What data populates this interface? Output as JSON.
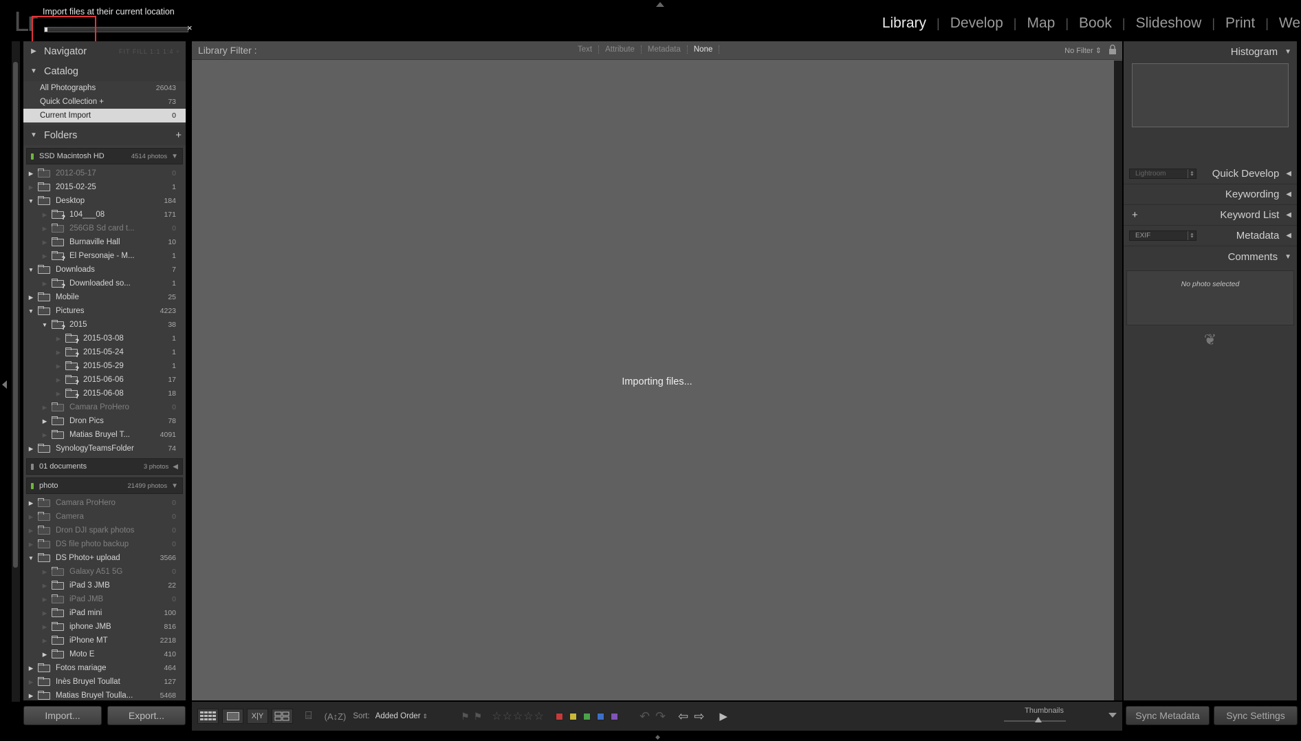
{
  "app": {
    "logo": "Lr"
  },
  "import_status": {
    "label": "Import files at their current location",
    "progress_pct": 2,
    "close_glyph": "×"
  },
  "modules": [
    "Library",
    "Develop",
    "Map",
    "Book",
    "Slideshow",
    "Print",
    "We"
  ],
  "active_module": "Library",
  "left": {
    "navigator": {
      "title": "Navigator",
      "zoom_options": "FIT  FILL  1:1  1:4 ÷"
    },
    "catalog": {
      "title": "Catalog",
      "items": [
        {
          "label": "All Photographs",
          "count": "26043"
        },
        {
          "label": "Quick Collection  +",
          "count": "73"
        },
        {
          "label": "Current Import",
          "count": "0"
        }
      ]
    },
    "folders": {
      "title": "Folders",
      "add": "+",
      "volumes": [
        {
          "name": "SSD Macintosh HD",
          "count": "4514 photos",
          "toggle": "▼",
          "led": "green"
        },
        {
          "name": "01 documents",
          "count": "3 photos",
          "toggle": "◀",
          "led": "gray"
        },
        {
          "name": "photo",
          "count": "21499 photos",
          "toggle": "▼",
          "led": "green"
        }
      ],
      "vol1_rows": [
        {
          "name": "2012-05-17",
          "count": "0",
          "level": 1,
          "dim": true,
          "tri": "▶",
          "q": false
        },
        {
          "name": "2015-02-25",
          "count": "1",
          "level": 1,
          "dim": false,
          "tri": "",
          "q": false
        },
        {
          "name": "Desktop",
          "count": "184",
          "level": 1,
          "dim": false,
          "tri": "▼",
          "q": false
        },
        {
          "name": "104___08",
          "count": "171",
          "level": 2,
          "dim": false,
          "tri": "",
          "q": true
        },
        {
          "name": "256GB Sd card t...",
          "count": "0",
          "level": 2,
          "dim": true,
          "tri": "",
          "q": false
        },
        {
          "name": "Burnaville Hall",
          "count": "10",
          "level": 2,
          "dim": false,
          "tri": "",
          "q": false
        },
        {
          "name": "El Personaje - M...",
          "count": "1",
          "level": 2,
          "dim": false,
          "tri": "",
          "q": true
        },
        {
          "name": "Downloads",
          "count": "7",
          "level": 1,
          "dim": false,
          "tri": "▼",
          "q": false
        },
        {
          "name": "Downloaded so...",
          "count": "1",
          "level": 2,
          "dim": false,
          "tri": "",
          "q": true
        },
        {
          "name": "Mobile",
          "count": "25",
          "level": 1,
          "dim": false,
          "tri": "▶",
          "q": false
        },
        {
          "name": "Pictures",
          "count": "4223",
          "level": 1,
          "dim": false,
          "tri": "▼",
          "q": false
        },
        {
          "name": "2015",
          "count": "38",
          "level": 2,
          "dim": false,
          "tri": "▼",
          "q": true
        },
        {
          "name": "2015-03-08",
          "count": "1",
          "level": 3,
          "dim": false,
          "tri": "",
          "q": true
        },
        {
          "name": "2015-05-24",
          "count": "1",
          "level": 3,
          "dim": false,
          "tri": "",
          "q": true
        },
        {
          "name": "2015-05-29",
          "count": "1",
          "level": 3,
          "dim": false,
          "tri": "",
          "q": true
        },
        {
          "name": "2015-06-06",
          "count": "17",
          "level": 3,
          "dim": false,
          "tri": "",
          "q": true
        },
        {
          "name": "2015-06-08",
          "count": "18",
          "level": 3,
          "dim": false,
          "tri": "",
          "q": true
        },
        {
          "name": "Camara ProHero",
          "count": "0",
          "level": 2,
          "dim": true,
          "tri": "",
          "q": false
        },
        {
          "name": "Dron Pics",
          "count": "78",
          "level": 2,
          "dim": false,
          "tri": "▶",
          "q": false
        },
        {
          "name": "Matias Bruyel T...",
          "count": "4091",
          "level": 2,
          "dim": false,
          "tri": "",
          "q": false
        },
        {
          "name": "SynologyTeamsFolder",
          "count": "74",
          "level": 1,
          "dim": false,
          "tri": "▶",
          "q": false
        }
      ],
      "vol3_rows": [
        {
          "name": "Camara ProHero",
          "count": "0",
          "level": 1,
          "dim": true,
          "tri": "▶",
          "q": false
        },
        {
          "name": "Camera",
          "count": "0",
          "level": 1,
          "dim": true,
          "tri": "",
          "q": false
        },
        {
          "name": "Dron DJI spark photos",
          "count": "0",
          "level": 1,
          "dim": true,
          "tri": "",
          "q": false
        },
        {
          "name": "DS file photo backup",
          "count": "0",
          "level": 1,
          "dim": true,
          "tri": "",
          "q": false
        },
        {
          "name": "DS Photo+ upload",
          "count": "3566",
          "level": 1,
          "dim": false,
          "tri": "▼",
          "q": false
        },
        {
          "name": "Galaxy A51 5G",
          "count": "0",
          "level": 2,
          "dim": true,
          "tri": "",
          "q": false
        },
        {
          "name": "iPad 3 JMB",
          "count": "22",
          "level": 2,
          "dim": false,
          "tri": "",
          "q": false
        },
        {
          "name": "iPad JMB",
          "count": "0",
          "level": 2,
          "dim": true,
          "tri": "",
          "q": false
        },
        {
          "name": "iPad mini",
          "count": "100",
          "level": 2,
          "dim": false,
          "tri": "",
          "q": false
        },
        {
          "name": "iphone JMB",
          "count": "816",
          "level": 2,
          "dim": false,
          "tri": "",
          "q": false
        },
        {
          "name": "iPhone MT",
          "count": "2218",
          "level": 2,
          "dim": false,
          "tri": "",
          "q": false
        },
        {
          "name": "Moto E",
          "count": "410",
          "level": 2,
          "dim": false,
          "tri": "▶",
          "q": false
        },
        {
          "name": "Fotos mariage",
          "count": "464",
          "level": 1,
          "dim": false,
          "tri": "▶",
          "q": false
        },
        {
          "name": "Inès Bruyel Toullat",
          "count": "127",
          "level": 1,
          "dim": false,
          "tri": "",
          "q": false
        },
        {
          "name": "Matias Bruyel Toulla...",
          "count": "5468",
          "level": 1,
          "dim": false,
          "tri": "▶",
          "q": false
        }
      ]
    },
    "import_button": "Import...",
    "export_button": "Export..."
  },
  "center": {
    "filter_label": "Library Filter :",
    "filter_tabs": [
      "Text",
      "Attribute",
      "Metadata",
      "None"
    ],
    "active_filter": "None",
    "no_filter": "No Filter",
    "status": "Importing files..."
  },
  "toolbar": {
    "sort_label": "Sort:",
    "sort_value": "Added Order",
    "stars": "☆☆☆☆☆",
    "colors": [
      "#c43b3b",
      "#c8b83a",
      "#4aa24a",
      "#3d6fc6",
      "#7f54b8"
    ],
    "thumbnails_label": "Thumbnails"
  },
  "right": {
    "histogram": "Histogram",
    "quick_develop": "Quick Develop",
    "qd_preset": "Lightroom",
    "keywording": "Keywording",
    "keyword_list": "Keyword List",
    "metadata": "Metadata",
    "metadata_preset": "EXIF",
    "comments": "Comments",
    "no_photo": "No photo selected",
    "sync_metadata": "Sync Metadata",
    "sync_settings": "Sync Settings"
  }
}
